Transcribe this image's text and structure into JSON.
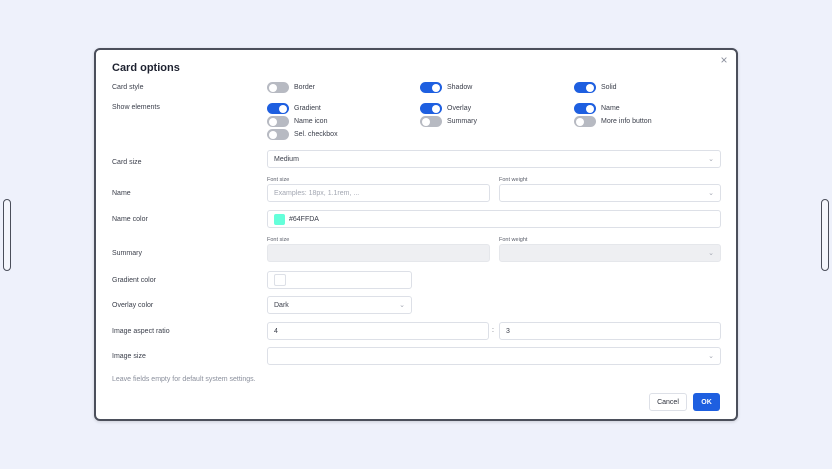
{
  "dialog": {
    "title": "Card options",
    "close_glyph": "×",
    "labels": {
      "card_style": "Card style",
      "show_elements": "Show elements",
      "card_size": "Card size",
      "name": "Name",
      "name_color": "Name color",
      "summary": "Summary",
      "gradient_color": "Gradient color",
      "overlay_color": "Overlay color",
      "image_aspect_ratio": "Image aspect ratio",
      "image_size": "Image size"
    },
    "card_style_toggles": [
      {
        "label": "Border",
        "on": false
      },
      {
        "label": "Shadow",
        "on": true
      },
      {
        "label": "Solid",
        "on": true
      }
    ],
    "show_elements_toggles": [
      {
        "label": "Gradient",
        "on": true
      },
      {
        "label": "Overlay",
        "on": true
      },
      {
        "label": "Name",
        "on": true
      },
      {
        "label": "Name icon",
        "on": false
      },
      {
        "label": "Summary",
        "on": false
      },
      {
        "label": "More info button",
        "on": false
      },
      {
        "label": "Sel. checkbox",
        "on": false
      }
    ],
    "card_size_value": "Medium",
    "font_size_label": "Font size",
    "font_weight_label": "Font weight",
    "name_font_size_placeholder": "Examples: 18px, 1.1rem, ...",
    "name_color_value": "#64FFDA",
    "name_color_hex": "#64FFDA",
    "overlay_color_value": "Dark",
    "aspect_ratio_w": "4",
    "aspect_ratio_h": "3",
    "ratio_separator": ":",
    "chevron": "⌄",
    "hint": "Leave fields empty for default system settings.",
    "cancel_label": "Cancel",
    "ok_label": "OK"
  }
}
